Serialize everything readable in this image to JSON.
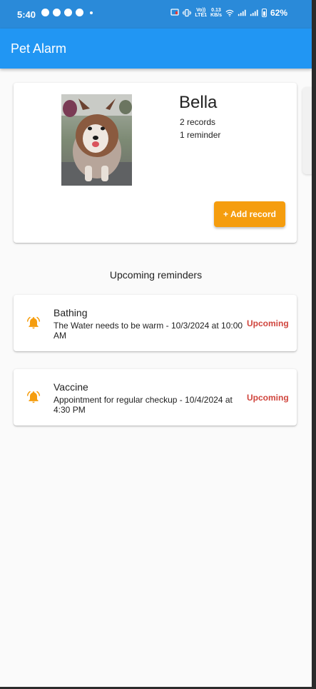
{
  "status_bar": {
    "time": "5:40",
    "net_speed": [
      "0.13",
      "KB/s"
    ],
    "net_label": [
      "Vo))",
      "LTE1"
    ],
    "battery": "62%"
  },
  "app_bar": {
    "title": "Pet Alarm"
  },
  "pet": {
    "name": "Bella",
    "records": "2 records",
    "reminders": "1 reminder",
    "add_record_label": "+ Add record"
  },
  "reminders_section": {
    "title": "Upcoming reminders",
    "items": [
      {
        "title": "Bathing",
        "description": "The Water needs to be warm - 10/3/2024 at 10:00 AM",
        "status": "Upcoming"
      },
      {
        "title": "Vaccine",
        "description": "Appointment for regular checkup  - 10/4/2024 at 4:30 PM",
        "status": "Upcoming"
      }
    ]
  },
  "colors": {
    "status_bar": "#2a8ad9",
    "app_bar": "#2196f3",
    "accent_orange": "#f59d0e",
    "status_red": "#d0453d",
    "background": "#fafafa"
  },
  "icons": {
    "reminder": "bell-icon",
    "cast": "cast-icon",
    "vibrate": "vibrate-icon",
    "wifi": "wifi-icon",
    "signal": "signal-icon",
    "battery": "battery-icon"
  }
}
